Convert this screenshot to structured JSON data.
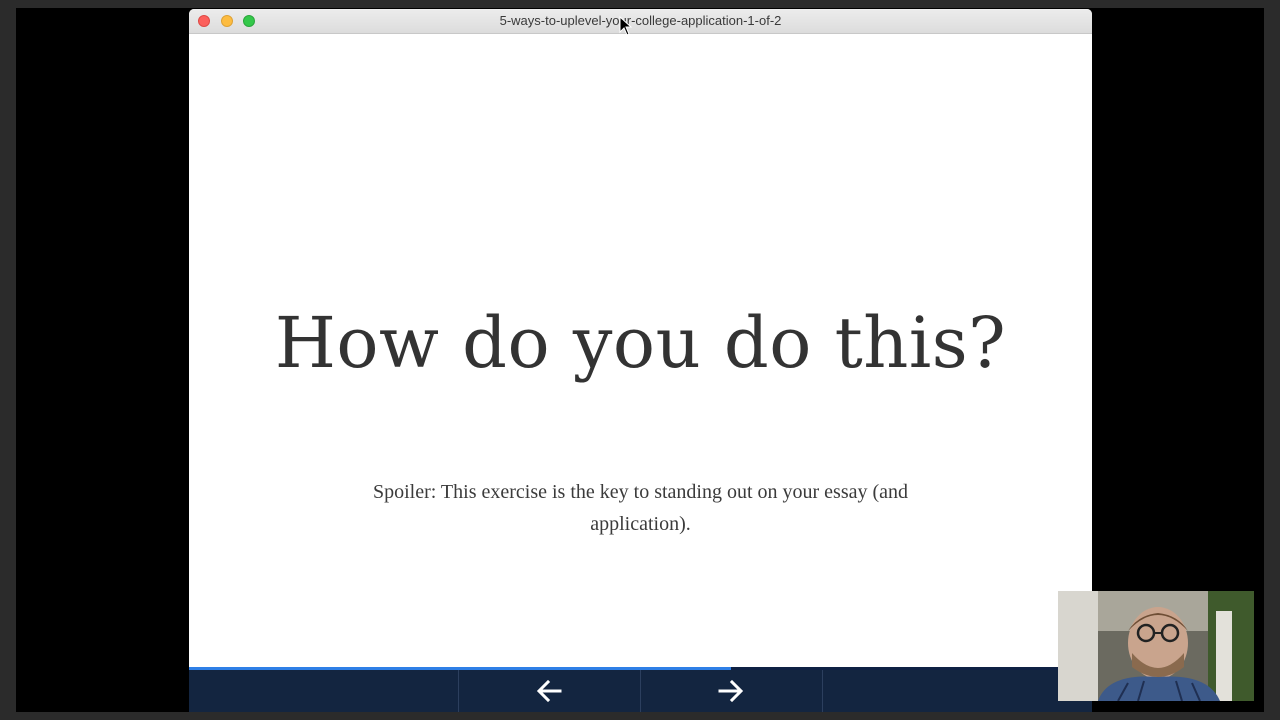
{
  "window": {
    "title": "5-ways-to-uplevel-your-college-application-1-of-2"
  },
  "slide": {
    "heading": "How do you do this?",
    "subtext": "Spoiler: This exercise is the key to standing out on your essay (and application)."
  },
  "progress": {
    "fraction": 0.6
  },
  "navigation": {
    "prev_icon": "arrow-left-icon",
    "next_icon": "arrow-right-icon"
  },
  "colors": {
    "navbar": "#132540",
    "progress_fill": "#2f7fe6",
    "heading": "#333333"
  }
}
